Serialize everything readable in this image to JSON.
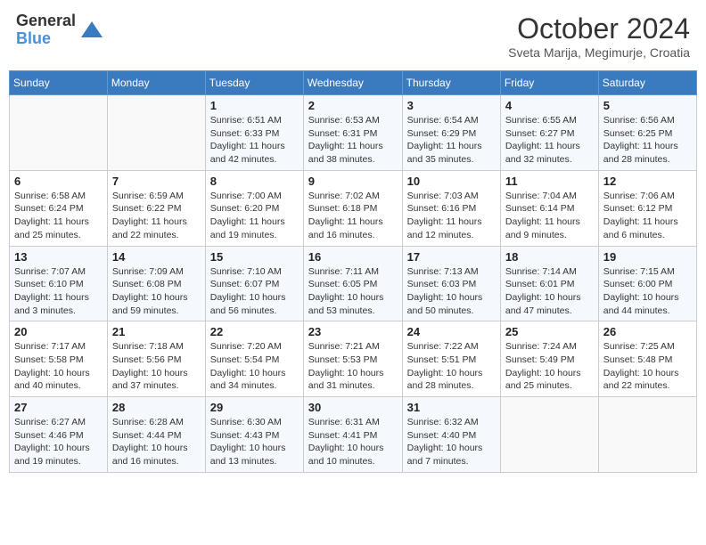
{
  "header": {
    "logo_general": "General",
    "logo_blue": "Blue",
    "month_title": "October 2024",
    "subtitle": "Sveta Marija, Megimurje, Croatia"
  },
  "weekdays": [
    "Sunday",
    "Monday",
    "Tuesday",
    "Wednesday",
    "Thursday",
    "Friday",
    "Saturday"
  ],
  "weeks": [
    [
      {
        "day": "",
        "info": ""
      },
      {
        "day": "",
        "info": ""
      },
      {
        "day": "1",
        "info": "Sunrise: 6:51 AM\nSunset: 6:33 PM\nDaylight: 11 hours and 42 minutes."
      },
      {
        "day": "2",
        "info": "Sunrise: 6:53 AM\nSunset: 6:31 PM\nDaylight: 11 hours and 38 minutes."
      },
      {
        "day": "3",
        "info": "Sunrise: 6:54 AM\nSunset: 6:29 PM\nDaylight: 11 hours and 35 minutes."
      },
      {
        "day": "4",
        "info": "Sunrise: 6:55 AM\nSunset: 6:27 PM\nDaylight: 11 hours and 32 minutes."
      },
      {
        "day": "5",
        "info": "Sunrise: 6:56 AM\nSunset: 6:25 PM\nDaylight: 11 hours and 28 minutes."
      }
    ],
    [
      {
        "day": "6",
        "info": "Sunrise: 6:58 AM\nSunset: 6:24 PM\nDaylight: 11 hours and 25 minutes."
      },
      {
        "day": "7",
        "info": "Sunrise: 6:59 AM\nSunset: 6:22 PM\nDaylight: 11 hours and 22 minutes."
      },
      {
        "day": "8",
        "info": "Sunrise: 7:00 AM\nSunset: 6:20 PM\nDaylight: 11 hours and 19 minutes."
      },
      {
        "day": "9",
        "info": "Sunrise: 7:02 AM\nSunset: 6:18 PM\nDaylight: 11 hours and 16 minutes."
      },
      {
        "day": "10",
        "info": "Sunrise: 7:03 AM\nSunset: 6:16 PM\nDaylight: 11 hours and 12 minutes."
      },
      {
        "day": "11",
        "info": "Sunrise: 7:04 AM\nSunset: 6:14 PM\nDaylight: 11 hours and 9 minutes."
      },
      {
        "day": "12",
        "info": "Sunrise: 7:06 AM\nSunset: 6:12 PM\nDaylight: 11 hours and 6 minutes."
      }
    ],
    [
      {
        "day": "13",
        "info": "Sunrise: 7:07 AM\nSunset: 6:10 PM\nDaylight: 11 hours and 3 minutes."
      },
      {
        "day": "14",
        "info": "Sunrise: 7:09 AM\nSunset: 6:08 PM\nDaylight: 10 hours and 59 minutes."
      },
      {
        "day": "15",
        "info": "Sunrise: 7:10 AM\nSunset: 6:07 PM\nDaylight: 10 hours and 56 minutes."
      },
      {
        "day": "16",
        "info": "Sunrise: 7:11 AM\nSunset: 6:05 PM\nDaylight: 10 hours and 53 minutes."
      },
      {
        "day": "17",
        "info": "Sunrise: 7:13 AM\nSunset: 6:03 PM\nDaylight: 10 hours and 50 minutes."
      },
      {
        "day": "18",
        "info": "Sunrise: 7:14 AM\nSunset: 6:01 PM\nDaylight: 10 hours and 47 minutes."
      },
      {
        "day": "19",
        "info": "Sunrise: 7:15 AM\nSunset: 6:00 PM\nDaylight: 10 hours and 44 minutes."
      }
    ],
    [
      {
        "day": "20",
        "info": "Sunrise: 7:17 AM\nSunset: 5:58 PM\nDaylight: 10 hours and 40 minutes."
      },
      {
        "day": "21",
        "info": "Sunrise: 7:18 AM\nSunset: 5:56 PM\nDaylight: 10 hours and 37 minutes."
      },
      {
        "day": "22",
        "info": "Sunrise: 7:20 AM\nSunset: 5:54 PM\nDaylight: 10 hours and 34 minutes."
      },
      {
        "day": "23",
        "info": "Sunrise: 7:21 AM\nSunset: 5:53 PM\nDaylight: 10 hours and 31 minutes."
      },
      {
        "day": "24",
        "info": "Sunrise: 7:22 AM\nSunset: 5:51 PM\nDaylight: 10 hours and 28 minutes."
      },
      {
        "day": "25",
        "info": "Sunrise: 7:24 AM\nSunset: 5:49 PM\nDaylight: 10 hours and 25 minutes."
      },
      {
        "day": "26",
        "info": "Sunrise: 7:25 AM\nSunset: 5:48 PM\nDaylight: 10 hours and 22 minutes."
      }
    ],
    [
      {
        "day": "27",
        "info": "Sunrise: 6:27 AM\nSunset: 4:46 PM\nDaylight: 10 hours and 19 minutes."
      },
      {
        "day": "28",
        "info": "Sunrise: 6:28 AM\nSunset: 4:44 PM\nDaylight: 10 hours and 16 minutes."
      },
      {
        "day": "29",
        "info": "Sunrise: 6:30 AM\nSunset: 4:43 PM\nDaylight: 10 hours and 13 minutes."
      },
      {
        "day": "30",
        "info": "Sunrise: 6:31 AM\nSunset: 4:41 PM\nDaylight: 10 hours and 10 minutes."
      },
      {
        "day": "31",
        "info": "Sunrise: 6:32 AM\nSunset: 4:40 PM\nDaylight: 10 hours and 7 minutes."
      },
      {
        "day": "",
        "info": ""
      },
      {
        "day": "",
        "info": ""
      }
    ]
  ]
}
